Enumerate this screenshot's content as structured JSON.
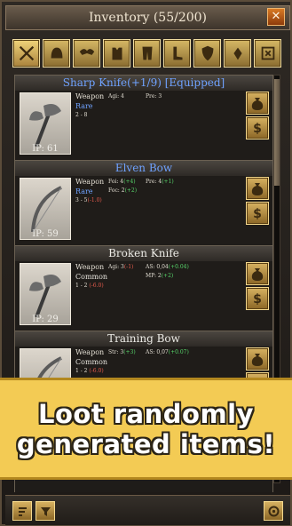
{
  "header": {
    "title": "Inventory (55/200)",
    "close_icon": "close-icon"
  },
  "tabs": [
    {
      "icon": "weapon-icon",
      "active": true
    },
    {
      "icon": "helmet-icon"
    },
    {
      "icon": "shoulders-icon"
    },
    {
      "icon": "chest-icon"
    },
    {
      "icon": "legs-icon"
    },
    {
      "icon": "boots-icon"
    },
    {
      "icon": "shield-icon"
    },
    {
      "icon": "amulet-icon"
    },
    {
      "icon": "misc-icon"
    }
  ],
  "items": [
    {
      "name": "Sharp Knife(+1/9) [Equipped]",
      "name_color": "blue",
      "type": "Weapon",
      "rarity": "Rare",
      "damage": "2 - 8",
      "damage_mod": "",
      "ip": "IP: 61",
      "stats": [
        {
          "label": "Agi: 4",
          "label_mod": "",
          "value": "Pre: 3",
          "value_mod": ""
        }
      ],
      "icon": "axe-icon"
    },
    {
      "name": "Elven Bow",
      "name_color": "blue",
      "type": "Weapon",
      "rarity": "Rare",
      "damage": "3 - 5",
      "damage_mod": "(-1.0)",
      "ip": "IP: 59",
      "stats": [
        {
          "label": "Foi: 4",
          "label_mod": "(+4)",
          "value": "Pre: 4",
          "value_mod": "(+1)"
        },
        {
          "label": "Foc: 2",
          "label_mod": "(+2)",
          "value": "",
          "value_mod": ""
        }
      ],
      "icon": "bow-icon"
    },
    {
      "name": "Broken Knife",
      "name_color": "white",
      "type": "Weapon",
      "rarity": "Common",
      "damage": "1 - 2",
      "damage_mod": "(-6.0)",
      "ip": "IP: 29",
      "stats": [
        {
          "label": "Agi: 3",
          "label_mod": "(-1)",
          "value": "AS: 0,04",
          "value_mod": "(+0.04)"
        },
        {
          "label": "",
          "label_mod": "",
          "value": "MP: 2",
          "value_mod": "(+2)"
        }
      ],
      "icon": "axe-icon"
    },
    {
      "name": "Training Bow",
      "name_color": "white",
      "type": "Weapon",
      "rarity": "Common",
      "damage": "1 - 2",
      "damage_mod": "(-6.0)",
      "ip": "",
      "stats": [
        {
          "label": "Str: 3",
          "label_mod": "(+3)",
          "value": "AS: 0,07",
          "value_mod": "(+0.07)"
        }
      ],
      "icon": "bow-icon"
    }
  ],
  "actions": {
    "loot_icon": "loot-bag-icon",
    "sell_icon": "sell-coin-icon"
  },
  "promo": {
    "line1": "Loot randomly",
    "line2": "generated items!"
  },
  "bottom": {
    "left_icons": [
      "sort-icon",
      "filter-icon"
    ],
    "right_icon": "settings-icon"
  },
  "colors": {
    "accent": "#d7b261",
    "rare": "#6fa2ff",
    "bonus": "#57d46a",
    "penalty": "#e45a4c",
    "promo_bg": "#f3cb54"
  }
}
